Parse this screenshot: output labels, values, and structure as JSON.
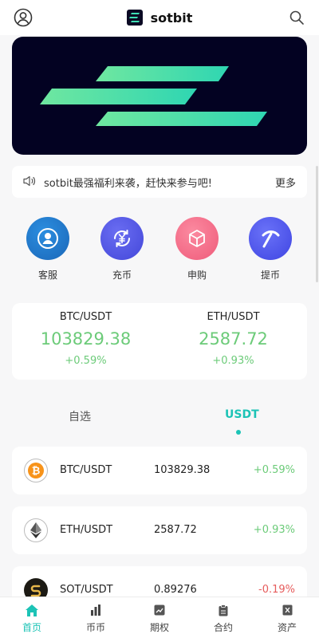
{
  "colors": {
    "accent": "#1cc3b6",
    "up": "#6ccb79",
    "down": "#e65c5c",
    "banner_bg": "#030222"
  },
  "header": {
    "title": "sotbit",
    "left_icon": "user-icon",
    "right_icon": "search-icon",
    "logo_icon": "sotbit-logo-icon"
  },
  "banner": {
    "image": "sotbit-logo-stripes"
  },
  "notice": {
    "icon": "speaker-icon",
    "text": "sotbit最强福利来袭，赶快来参与吧!",
    "more_label": "更多"
  },
  "quick_actions": [
    {
      "label": "客服",
      "icon": "customer-service-icon",
      "color": "#1b73c6"
    },
    {
      "label": "充币",
      "icon": "deposit-icon",
      "color": "#5558e8"
    },
    {
      "label": "申购",
      "icon": "subscribe-box-icon",
      "color": "#f26a86"
    },
    {
      "label": "提币",
      "icon": "withdraw-pickaxe-icon",
      "color": "#4f56ea"
    }
  ],
  "tickers": [
    {
      "pair": "BTC/USDT",
      "price": "103829.38",
      "change": "+0.59%"
    },
    {
      "pair": "ETH/USDT",
      "price": "2587.72",
      "change": "+0.93%"
    }
  ],
  "market_tabs": [
    {
      "label": "自选",
      "active": false
    },
    {
      "label": "USDT",
      "active": true
    }
  ],
  "markets": [
    {
      "pair": "BTC/USDT",
      "price": "103829.38",
      "change": "+0.59%",
      "direction": "up",
      "icon": "bitcoin-icon"
    },
    {
      "pair": "ETH/USDT",
      "price": "2587.72",
      "change": "+0.93%",
      "direction": "up",
      "icon": "ethereum-icon"
    },
    {
      "pair": "SOT/USDT",
      "price": "0.89276",
      "change": "-0.19%",
      "direction": "down",
      "icon": "sot-coin-icon"
    }
  ],
  "tabbar": [
    {
      "label": "首页",
      "icon": "home-icon",
      "active": true
    },
    {
      "label": "币币",
      "icon": "bar-chart-icon",
      "active": false
    },
    {
      "label": "期权",
      "icon": "options-chart-icon",
      "active": false
    },
    {
      "label": "合约",
      "icon": "contract-clipboard-icon",
      "active": false
    },
    {
      "label": "资产",
      "icon": "assets-wallet-icon",
      "active": false
    }
  ]
}
